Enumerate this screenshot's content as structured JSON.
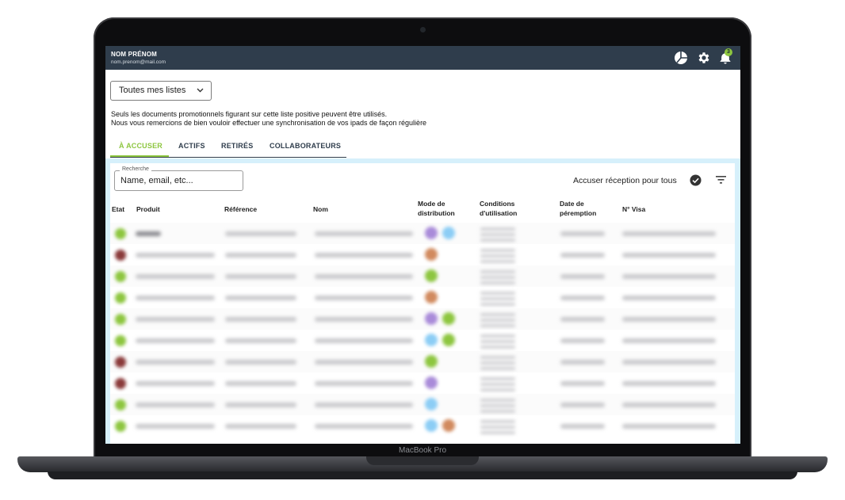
{
  "device": {
    "label": "MacBook Pro"
  },
  "header": {
    "user_name": "NOM PRÉNOM",
    "user_email": "nom.prenom@mail.com",
    "notifications_count": "3",
    "icons": [
      "pie-chart-icon",
      "gear-icon",
      "bell-icon"
    ]
  },
  "list_select": {
    "value": "Toutes mes listes"
  },
  "info": {
    "line1": "Seuls les documents promotionnels figurant sur cette liste positive peuvent être utilisés.",
    "line2": "Nous vous remercions de bien vouloir effectuer une synchronisation de vos ipads de façon régulière"
  },
  "tabs": [
    {
      "label": "À ACCUSER",
      "active": true
    },
    {
      "label": "ACTIFS",
      "active": false
    },
    {
      "label": "RETIRÉS",
      "active": false
    },
    {
      "label": "COLLABORATEURS",
      "active": false
    }
  ],
  "search": {
    "label": "Recherche",
    "placeholder": "Name, email, etc..."
  },
  "toolbar": {
    "ack_all_label": "Accuser réception pour tous"
  },
  "table": {
    "columns": [
      {
        "key": "etat",
        "label": "Etat"
      },
      {
        "key": "produit",
        "label": "Produit"
      },
      {
        "key": "reference",
        "label": "Référence"
      },
      {
        "key": "nom",
        "label": "Nom"
      },
      {
        "key": "mode",
        "label": "Mode de distribution"
      },
      {
        "key": "conditions",
        "label": "Conditions d'utilisation"
      },
      {
        "key": "peremption",
        "label": "Date de péremption"
      },
      {
        "key": "visa",
        "label": "N° Visa"
      }
    ],
    "rows": [
      {
        "status": "green",
        "modes": [
          "purple",
          "blue"
        ]
      },
      {
        "status": "red",
        "modes": [
          "orange"
        ]
      },
      {
        "status": "green",
        "modes": [
          "green"
        ]
      },
      {
        "status": "green",
        "modes": [
          "orange"
        ]
      },
      {
        "status": "green",
        "modes": [
          "purple",
          "green"
        ]
      },
      {
        "status": "green",
        "modes": [
          "blue",
          "green"
        ]
      },
      {
        "status": "red",
        "modes": [
          "green"
        ]
      },
      {
        "status": "red",
        "modes": [
          "purple"
        ]
      },
      {
        "status": "green",
        "modes": [
          "blue"
        ]
      },
      {
        "status": "green",
        "modes": [
          "blue",
          "orange"
        ]
      }
    ]
  },
  "colors": {
    "header_bg": "#2f3d4c",
    "accent": "#8dc63f",
    "panel_bg": "#d6f0fb",
    "green": "#8dc63f",
    "red": "#8a3a3a",
    "purple": "#a98bd9",
    "blue": "#8ccdf5",
    "orange": "#d18a5e"
  }
}
